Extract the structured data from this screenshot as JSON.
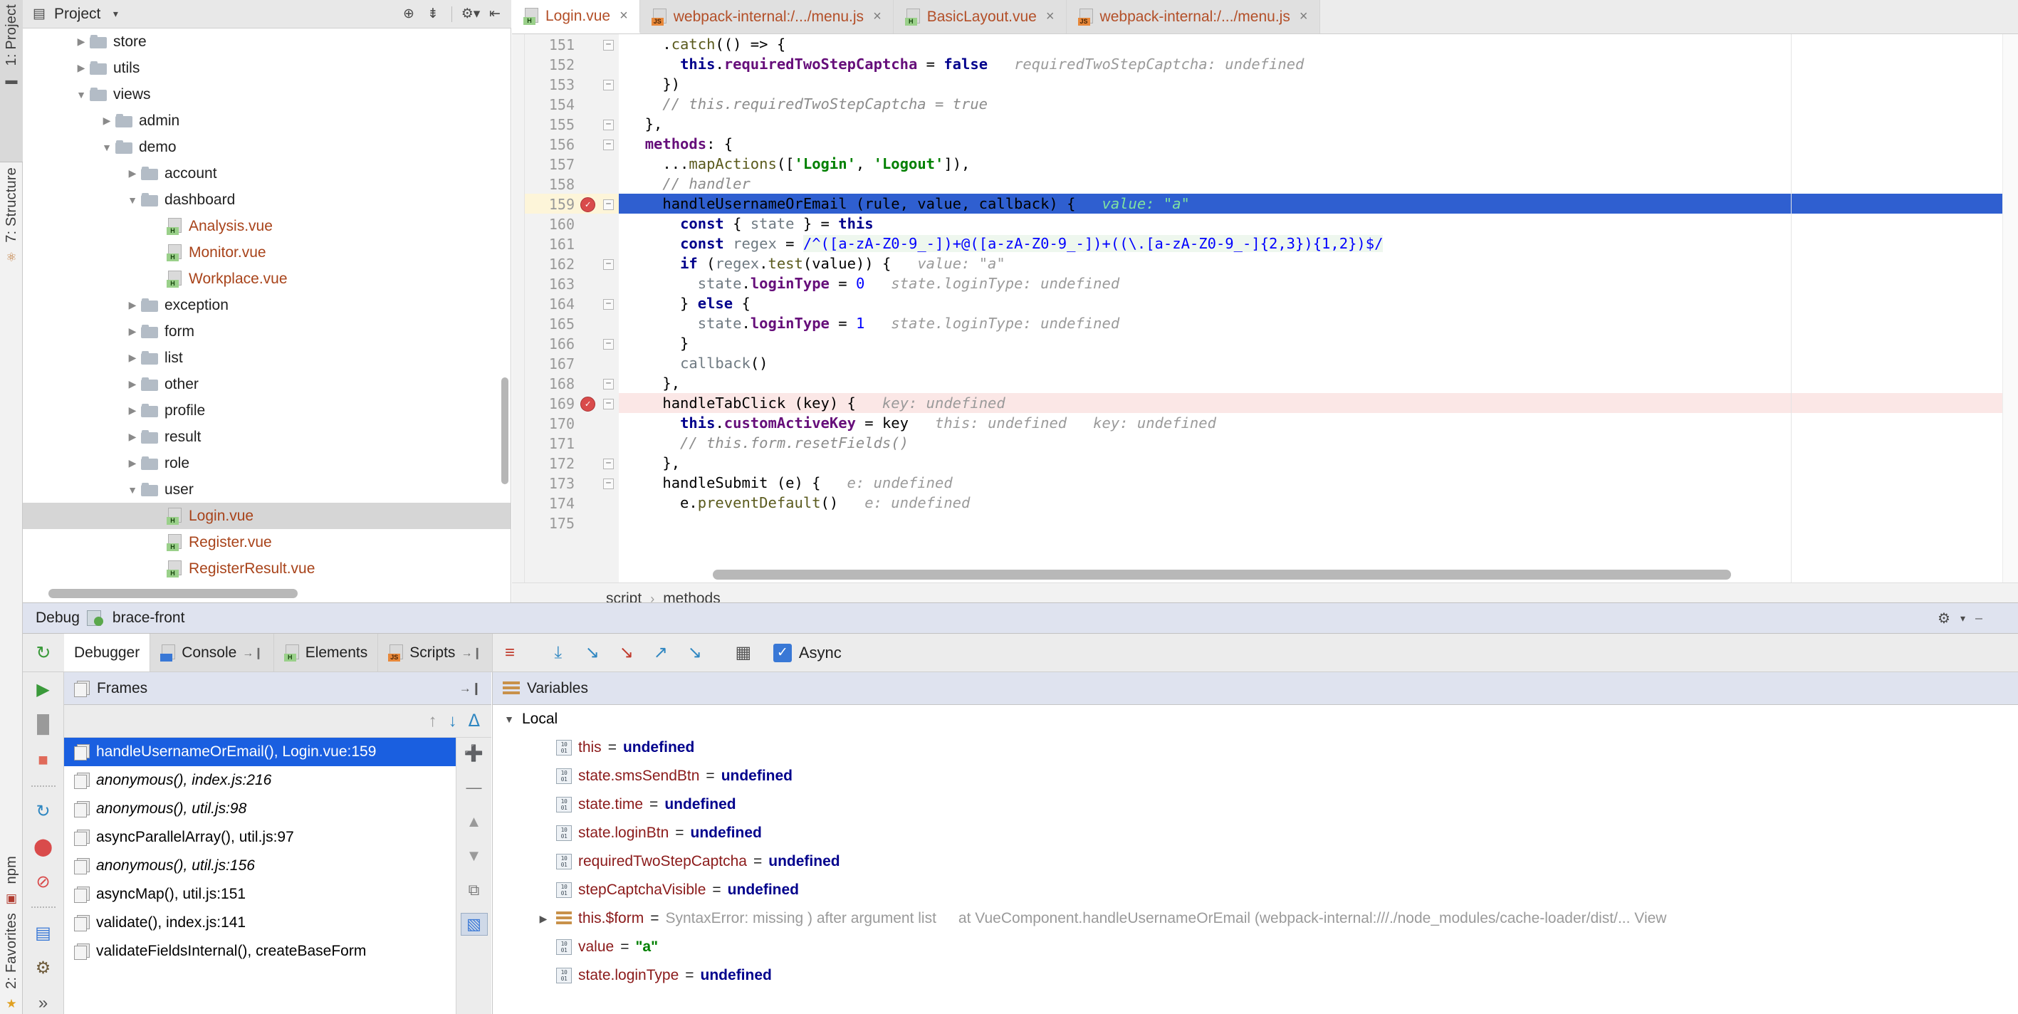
{
  "rail": {
    "top_items": [
      {
        "label": "1: Project",
        "icon": "project-icon"
      }
    ],
    "mid_items": [
      {
        "label": "7: Structure",
        "icon": "structure-icon"
      }
    ],
    "bottom_items": [
      {
        "label": "npm",
        "icon": "npm-icon"
      },
      {
        "label": "2: Favorites",
        "icon": "star-icon"
      }
    ],
    "expand_glyph": "▬"
  },
  "project_panel": {
    "title": "Project",
    "dropdown_glyph": "▾",
    "toolbar_icons": [
      "locate-icon",
      "collapse-all-icon",
      "settings-gear-icon",
      "hide-panel-icon"
    ],
    "tree": [
      {
        "indent": 1,
        "state": "closed",
        "type": "folder",
        "label": "store"
      },
      {
        "indent": 1,
        "state": "closed",
        "type": "folder",
        "label": "utils"
      },
      {
        "indent": 1,
        "state": "open",
        "type": "folder",
        "label": "views"
      },
      {
        "indent": 2,
        "state": "closed",
        "type": "folder",
        "label": "admin"
      },
      {
        "indent": 2,
        "state": "open",
        "type": "folder",
        "label": "demo"
      },
      {
        "indent": 3,
        "state": "closed",
        "type": "folder",
        "label": "account"
      },
      {
        "indent": 3,
        "state": "open",
        "type": "folder",
        "label": "dashboard"
      },
      {
        "indent": 4,
        "state": "none",
        "type": "vue",
        "label": "Analysis.vue"
      },
      {
        "indent": 4,
        "state": "none",
        "type": "vue",
        "label": "Monitor.vue"
      },
      {
        "indent": 4,
        "state": "none",
        "type": "vue",
        "label": "Workplace.vue"
      },
      {
        "indent": 3,
        "state": "closed",
        "type": "folder",
        "label": "exception"
      },
      {
        "indent": 3,
        "state": "closed",
        "type": "folder",
        "label": "form"
      },
      {
        "indent": 3,
        "state": "closed",
        "type": "folder",
        "label": "list"
      },
      {
        "indent": 3,
        "state": "closed",
        "type": "folder",
        "label": "other"
      },
      {
        "indent": 3,
        "state": "closed",
        "type": "folder",
        "label": "profile"
      },
      {
        "indent": 3,
        "state": "closed",
        "type": "folder",
        "label": "result"
      },
      {
        "indent": 3,
        "state": "closed",
        "type": "folder",
        "label": "role"
      },
      {
        "indent": 3,
        "state": "open",
        "type": "folder",
        "label": "user"
      },
      {
        "indent": 4,
        "state": "none",
        "type": "vue",
        "label": "Login.vue",
        "selected": true
      },
      {
        "indent": 4,
        "state": "none",
        "type": "vue",
        "label": "Register.vue"
      },
      {
        "indent": 4,
        "state": "none",
        "type": "vue",
        "label": "RegisterResult.vue"
      }
    ]
  },
  "editor_tabs": [
    {
      "label": "Login.vue",
      "badge": "H",
      "badge_kind": "h",
      "active": true,
      "close": "×"
    },
    {
      "label": "webpack-internal:/.../menu.js",
      "badge": "JS",
      "badge_kind": "js",
      "active": false,
      "close": "×"
    },
    {
      "label": "BasicLayout.vue",
      "badge": "H",
      "badge_kind": "h",
      "active": false,
      "close": "×"
    },
    {
      "label": "webpack-internal:/.../menu.js",
      "badge": "JS",
      "badge_kind": "js",
      "active": false,
      "close": "×"
    }
  ],
  "editor": {
    "first_line": 151,
    "last_line": 175,
    "breakpoint_lines": [
      159,
      169
    ],
    "current_line": 159,
    "error_line": 169,
    "fold_lines": [
      151,
      153,
      155,
      156,
      159,
      162,
      164,
      166,
      168,
      169,
      172,
      173
    ],
    "lines": [
      {
        "n": 151,
        "text": "    .catch(() => {"
      },
      {
        "n": 152,
        "text": "      this.requiredTwoStepCaptcha = false",
        "hint": "requiredTwoStepCaptcha: undefined"
      },
      {
        "n": 153,
        "text": "    })"
      },
      {
        "n": 154,
        "text": "    // this.requiredTwoStepCaptcha = true"
      },
      {
        "n": 155,
        "text": "  },"
      },
      {
        "n": 156,
        "text": "  methods: {"
      },
      {
        "n": 157,
        "text": "    ...mapActions(['Login', 'Logout']),"
      },
      {
        "n": 158,
        "text": "    // handler"
      },
      {
        "n": 159,
        "text": "    handleUsernameOrEmail (rule, value, callback) {",
        "hint": "value: \"a\""
      },
      {
        "n": 160,
        "text": "      const { state } = this"
      },
      {
        "n": 161,
        "text": "      const regex = /^([a-zA-Z0-9_-])+@([a-zA-Z0-9_-])+((\\.[a-zA-Z0-9_-]{2,3}){1,2})$/"
      },
      {
        "n": 162,
        "text": "      if (regex.test(value)) {",
        "hint": "value: \"a\""
      },
      {
        "n": 163,
        "text": "        state.loginType = 0",
        "hint": "state.loginType: undefined"
      },
      {
        "n": 164,
        "text": "      } else {"
      },
      {
        "n": 165,
        "text": "        state.loginType = 1",
        "hint": "state.loginType: undefined"
      },
      {
        "n": 166,
        "text": "      }"
      },
      {
        "n": 167,
        "text": "      callback()"
      },
      {
        "n": 168,
        "text": "    },"
      },
      {
        "n": 169,
        "text": "    handleTabClick (key) {",
        "hint": "key: undefined"
      },
      {
        "n": 170,
        "text": "      this.customActiveKey = key",
        "hint": "this: undefined   key: undefined"
      },
      {
        "n": 171,
        "text": "      // this.form.resetFields()"
      },
      {
        "n": 172,
        "text": "    },"
      },
      {
        "n": 173,
        "text": "    handleSubmit (e) {",
        "hint": "e: undefined"
      },
      {
        "n": 174,
        "text": "      e.preventDefault()",
        "hint": "e: undefined"
      },
      {
        "n": 175,
        "text": ""
      }
    ]
  },
  "breadcrumb": {
    "items": [
      "script",
      "methods"
    ],
    "separator": "›"
  },
  "debug_header": {
    "label": "Debug",
    "config_name": "brace-front",
    "settings_glyph": "⚙",
    "dropdown_glyph": "▾"
  },
  "debug_toolbar": {
    "rerun_glyph": "↻",
    "tabs": [
      {
        "label": "Debugger",
        "active": true,
        "icon": "none",
        "pin": ""
      },
      {
        "label": "Console",
        "active": false,
        "icon": "console-icon",
        "pin": "→❙"
      },
      {
        "label": "Elements",
        "active": false,
        "icon": "elements-icon",
        "pin": ""
      },
      {
        "label": "Scripts",
        "active": false,
        "icon": "scripts-icon",
        "pin": "→❙"
      }
    ],
    "step_buttons": [
      {
        "name": "show-execution-point-icon",
        "glyph": "≡",
        "color": "#c0392b"
      },
      {
        "name": "step-over-icon",
        "glyph": "⤓",
        "color": "#2e86c1"
      },
      {
        "name": "step-into-icon",
        "glyph": "↘",
        "color": "#2e86c1"
      },
      {
        "name": "force-step-into-icon",
        "glyph": "↘",
        "color": "#c0392b"
      },
      {
        "name": "step-out-icon",
        "glyph": "↗",
        "color": "#2e86c1"
      },
      {
        "name": "run-to-cursor-icon",
        "glyph": "↘",
        "color": "#2e86c1"
      },
      {
        "name": "evaluate-expression-icon",
        "glyph": "▦",
        "color": "#555555"
      }
    ],
    "async_checkbox": {
      "label": "Async",
      "checked": true,
      "check_glyph": "✓"
    }
  },
  "debug_side_buttons": [
    {
      "name": "resume-program-icon",
      "glyph": "▶",
      "color": "#3a9a3a"
    },
    {
      "name": "pause-program-icon",
      "glyph": "▐▌",
      "color": "#9a9a9a"
    },
    {
      "name": "stop-icon",
      "glyph": "■",
      "color": "#e06a5a"
    },
    {
      "name": "restart-icon",
      "glyph": "↻",
      "color": "#2e86c1"
    },
    {
      "name": "view-breakpoints-icon",
      "glyph": "⬤",
      "color": "#d94b4b"
    },
    {
      "name": "mute-breakpoints-icon",
      "glyph": "⊘",
      "color": "#d94b4b"
    },
    {
      "name": "layout-settings-icon",
      "glyph": "▤",
      "color": "#3978d6"
    },
    {
      "name": "settings-gear-icon",
      "glyph": "⚙",
      "color": "#6d5a3a"
    },
    {
      "name": "more-icon",
      "glyph": "»",
      "color": "#555555"
    }
  ],
  "frames": {
    "title": "Frames",
    "pin_glyph": "→❙",
    "toolbar": [
      {
        "name": "frames-up-icon",
        "glyph": "↑",
        "color": "#9a9a9a"
      },
      {
        "name": "frames-down-icon",
        "glyph": "↓",
        "color": "#2e86c1"
      },
      {
        "name": "frames-filter-icon",
        "glyph": "ᐃ",
        "color": "#2e86c1"
      }
    ],
    "items": [
      {
        "label": "handleUsernameOrEmail(), Login.vue:159",
        "selected": true,
        "italic": false
      },
      {
        "label": "anonymous(), index.js:216",
        "selected": false,
        "italic": true
      },
      {
        "label": "anonymous(), util.js:98",
        "selected": false,
        "italic": true
      },
      {
        "label": "asyncParallelArray(), util.js:97",
        "selected": false,
        "italic": false
      },
      {
        "label": "anonymous(), util.js:156",
        "selected": false,
        "italic": true
      },
      {
        "label": "asyncMap(), util.js:151",
        "selected": false,
        "italic": false
      },
      {
        "label": "validate(), index.js:141",
        "selected": false,
        "italic": false
      },
      {
        "label": "validateFieldsInternal(), createBaseForm",
        "selected": false,
        "italic": false
      }
    ],
    "side_buttons": [
      {
        "name": "add-watch-icon",
        "glyph": "➕",
        "color": "#3a9a3a"
      },
      {
        "name": "remove-watch-icon",
        "glyph": "—",
        "color": "#777777"
      },
      {
        "name": "move-up-icon",
        "glyph": "▲",
        "color": "#9a9a9a"
      },
      {
        "name": "move-down-icon",
        "glyph": "▼",
        "color": "#9a9a9a"
      },
      {
        "name": "copy-value-icon",
        "glyph": "⧉",
        "color": "#777777"
      },
      {
        "name": "watches-in-variables-icon",
        "glyph": "▧",
        "color": "#3978d6"
      }
    ]
  },
  "variables": {
    "title": "Variables",
    "scope_label": "Local",
    "rows": [
      {
        "name": "this",
        "value": "undefined",
        "kind": "undef",
        "icon": "primitive-icon",
        "expandable": false
      },
      {
        "name": "state.smsSendBtn",
        "value": "undefined",
        "kind": "undef",
        "icon": "primitive-icon",
        "expandable": false
      },
      {
        "name": "state.time",
        "value": "undefined",
        "kind": "undef",
        "icon": "primitive-icon",
        "expandable": false
      },
      {
        "name": "state.loginBtn",
        "value": "undefined",
        "kind": "undef",
        "icon": "primitive-icon",
        "expandable": false
      },
      {
        "name": "requiredTwoStepCaptcha",
        "value": "undefined",
        "kind": "undef",
        "icon": "primitive-icon",
        "expandable": false
      },
      {
        "name": "stepCaptchaVisible",
        "value": "undefined",
        "kind": "undef",
        "icon": "primitive-icon",
        "expandable": false
      },
      {
        "name": "this.$form",
        "value": "SyntaxError: missing ) after argument list",
        "kind": "error",
        "icon": "object-icon",
        "expandable": true,
        "tail": "at VueComponent.handleUsernameOrEmail (webpack-internal:///./node_modules/cache-loader/dist/... View"
      },
      {
        "name": "value",
        "value": "\"a\"",
        "kind": "string",
        "icon": "primitive-icon",
        "expandable": false
      },
      {
        "name": "state.loginType",
        "value": "undefined",
        "kind": "undef",
        "icon": "primitive-icon",
        "expandable": false
      }
    ]
  },
  "colors": {
    "selection_blue": "#1a5fe0",
    "current_line_blue": "#2f5fd0",
    "breakpoint_red": "#d94b4b",
    "error_line": "#fbe7e6",
    "vue_file_orange": "#a8431a",
    "panel_header": "#dfe3ef"
  }
}
